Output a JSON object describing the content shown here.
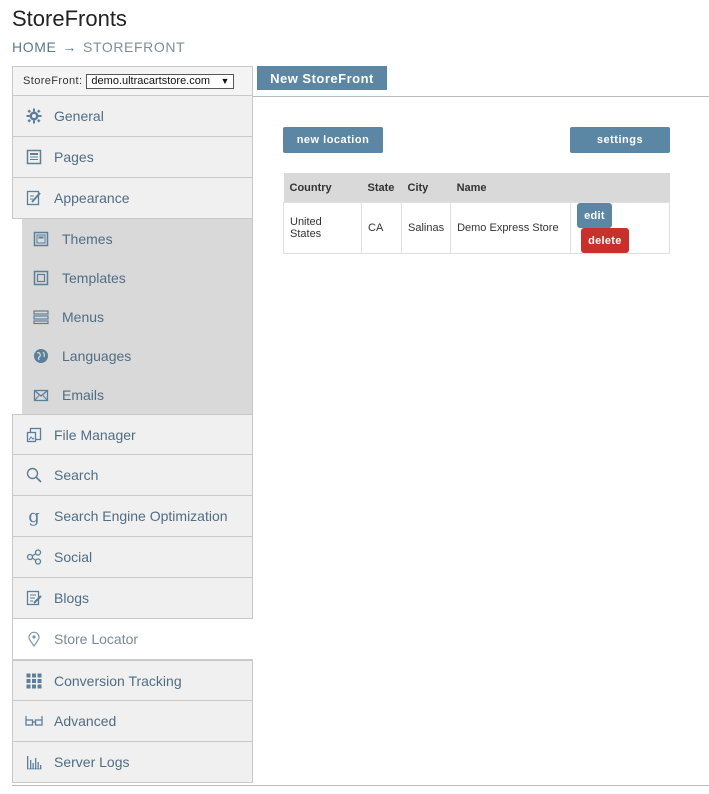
{
  "header": {
    "title": "StoreFronts",
    "breadcrumb": {
      "home": "HOME",
      "separator": "→",
      "current": "STOREFRONT"
    }
  },
  "storefront_selector": {
    "label": "StoreFront:",
    "selected": "demo.ultracartstore.com"
  },
  "top_tab": {
    "label": "New StoreFront"
  },
  "sidebar": {
    "items": [
      {
        "label": "General",
        "icon": "gear-icon"
      },
      {
        "label": "Pages",
        "icon": "page-icon"
      },
      {
        "label": "Appearance",
        "icon": "appearance-icon"
      }
    ],
    "subitems": [
      {
        "label": "Themes",
        "icon": "themes-icon"
      },
      {
        "label": "Templates",
        "icon": "templates-icon"
      },
      {
        "label": "Menus",
        "icon": "menu-icon"
      },
      {
        "label": "Languages",
        "icon": "globe-icon"
      },
      {
        "label": "Emails",
        "icon": "email-icon"
      }
    ],
    "items_after": [
      {
        "label": "File Manager",
        "icon": "file-manager-icon"
      },
      {
        "label": "Search",
        "icon": "search-icon"
      },
      {
        "label": "Search Engine Optimization",
        "icon": "google-icon"
      },
      {
        "label": "Social",
        "icon": "share-icon"
      },
      {
        "label": "Blogs",
        "icon": "blog-icon"
      },
      {
        "label": "Store Locator",
        "icon": "location-pin-icon",
        "active": true
      },
      {
        "label": "Conversion Tracking",
        "icon": "grid-icon"
      },
      {
        "label": "Advanced",
        "icon": "glasses-icon"
      },
      {
        "label": "Server Logs",
        "icon": "bar-chart-icon"
      }
    ]
  },
  "main": {
    "new_location_label": "new location",
    "settings_label": "settings",
    "table": {
      "columns": [
        "Country",
        "State",
        "City",
        "Name",
        ""
      ],
      "rows": [
        {
          "country": "United States",
          "state": "CA",
          "city": "Salinas",
          "name": "Demo Express Store",
          "edit_label": "edit",
          "delete_label": "delete"
        }
      ]
    }
  },
  "colors": {
    "accent": "#5b86a4",
    "danger": "#c9302c",
    "nav_text": "#506d84",
    "submenu_bg": "#d9d9d9"
  }
}
